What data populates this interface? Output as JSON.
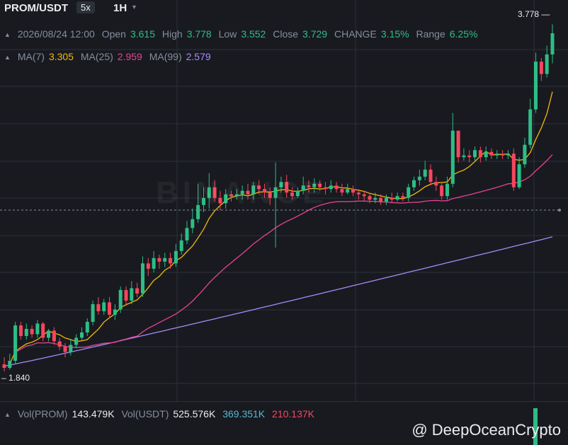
{
  "header": {
    "pair": "PROM/USDT",
    "leverage": "5x",
    "interval": "1H",
    "interval_caret": "▾"
  },
  "ohlc": {
    "time": "2026/08/24 12:00",
    "open_label": "Open",
    "open": "3.615",
    "high_label": "High",
    "high": "3.778",
    "low_label": "Low",
    "low": "3.552",
    "close_label": "Close",
    "close": "3.729",
    "change_label": "CHANGE",
    "change": "3.15%",
    "range_label": "Range",
    "range": "6.25%"
  },
  "ma": {
    "ma7_label": "MA(7)",
    "ma7": "3.305",
    "ma25_label": "MA(25)",
    "ma25": "2.959",
    "ma99_label": "MA(99)",
    "ma99": "2.579"
  },
  "markers": {
    "high": "3.778",
    "low": "1.840"
  },
  "volume": {
    "vol_prom_label": "Vol(PROM)",
    "vol_prom": "143.479K",
    "vol_usdt_label": "Vol(USDT)",
    "vol_usdt": "525.576K",
    "vol_a": "369.351K",
    "vol_b": "210.137K"
  },
  "watermark": {
    "logo_text": "BINANCE",
    "handle": "@ DeepOceanCrypto"
  },
  "colors": {
    "up": "#2ebd85",
    "down": "#f6465d",
    "ma7": "#f0b90b",
    "ma25": "#e84393",
    "ma99": "#a78bfa",
    "background": "#181a20",
    "grid": "#2b3139"
  },
  "chart_data": {
    "type": "candlestick",
    "title": "PROM/USDT",
    "interval": "1H",
    "ylim": [
      1.75,
      3.85
    ],
    "candles": [
      [
        1.86,
        1.84,
        1.82,
        1.9
      ],
      [
        1.84,
        1.88,
        1.83,
        1.92
      ],
      [
        1.88,
        2.08,
        1.86,
        2.1
      ],
      [
        2.08,
        2.02,
        2.0,
        2.1
      ],
      [
        2.02,
        2.06,
        2.0,
        2.09
      ],
      [
        2.06,
        2.03,
        2.01,
        2.08
      ],
      [
        2.03,
        2.09,
        2.01,
        2.11
      ],
      [
        2.09,
        2.01,
        1.99,
        2.1
      ],
      [
        2.01,
        2.05,
        1.99,
        2.06
      ],
      [
        2.05,
        1.99,
        1.97,
        2.07
      ],
      [
        1.99,
        1.96,
        1.94,
        2.01
      ],
      [
        1.96,
        1.93,
        1.9,
        1.98
      ],
      [
        1.93,
        1.97,
        1.91,
        2.0
      ],
      [
        1.97,
        2.01,
        1.95,
        2.03
      ],
      [
        2.01,
        2.04,
        1.99,
        2.07
      ],
      [
        2.04,
        2.1,
        2.02,
        2.12
      ],
      [
        2.1,
        2.2,
        2.08,
        2.22
      ],
      [
        2.2,
        2.16,
        2.14,
        2.24
      ],
      [
        2.16,
        2.21,
        2.14,
        2.23
      ],
      [
        2.21,
        2.14,
        2.12,
        2.24
      ],
      [
        2.14,
        2.17,
        2.11,
        2.2
      ],
      [
        2.17,
        2.28,
        2.15,
        2.3
      ],
      [
        2.28,
        2.22,
        2.19,
        2.3
      ],
      [
        2.22,
        2.29,
        2.2,
        2.33
      ],
      [
        2.29,
        2.26,
        2.24,
        2.32
      ],
      [
        2.26,
        2.43,
        2.24,
        2.47
      ],
      [
        2.43,
        2.4,
        2.36,
        2.46
      ],
      [
        2.4,
        2.46,
        2.38,
        2.5
      ],
      [
        2.46,
        2.44,
        2.4,
        2.48
      ],
      [
        2.44,
        2.46,
        2.41,
        2.49
      ],
      [
        2.46,
        2.43,
        2.4,
        2.49
      ],
      [
        2.43,
        2.5,
        2.41,
        2.54
      ],
      [
        2.5,
        2.56,
        2.48,
        2.6
      ],
      [
        2.56,
        2.63,
        2.54,
        2.67
      ],
      [
        2.63,
        2.68,
        2.6,
        2.74
      ],
      [
        2.68,
        2.76,
        2.66,
        2.88
      ],
      [
        2.76,
        2.8,
        2.72,
        2.86
      ],
      [
        2.8,
        2.86,
        2.74,
        2.94
      ],
      [
        2.86,
        2.8,
        2.78,
        2.9
      ],
      [
        2.8,
        2.77,
        2.73,
        2.84
      ],
      [
        2.77,
        2.82,
        2.74,
        2.85
      ],
      [
        2.82,
        2.81,
        2.78,
        2.84
      ],
      [
        2.81,
        2.82,
        2.79,
        2.85
      ],
      [
        2.82,
        2.84,
        2.79,
        2.87
      ],
      [
        2.84,
        2.82,
        2.79,
        2.88
      ],
      [
        2.82,
        2.87,
        2.79,
        2.89
      ],
      [
        2.87,
        2.85,
        2.82,
        2.9
      ],
      [
        2.85,
        2.83,
        2.8,
        2.88
      ],
      [
        2.83,
        2.8,
        2.76,
        2.86
      ],
      [
        2.8,
        2.86,
        2.52,
        3.0
      ],
      [
        2.86,
        2.89,
        2.83,
        2.92
      ],
      [
        2.89,
        2.83,
        2.8,
        2.93
      ],
      [
        2.83,
        2.81,
        2.79,
        2.86
      ],
      [
        2.81,
        2.84,
        2.8,
        2.86
      ],
      [
        2.84,
        2.87,
        2.82,
        2.92
      ],
      [
        2.87,
        2.86,
        2.83,
        2.9
      ],
      [
        2.86,
        2.88,
        2.83,
        2.91
      ],
      [
        2.88,
        2.86,
        2.84,
        2.9
      ],
      [
        2.86,
        2.85,
        2.82,
        2.89
      ],
      [
        2.85,
        2.87,
        2.83,
        2.9
      ],
      [
        2.87,
        2.85,
        2.83,
        2.89
      ],
      [
        2.85,
        2.83,
        2.81,
        2.88
      ],
      [
        2.83,
        2.85,
        2.82,
        2.88
      ],
      [
        2.85,
        2.83,
        2.81,
        2.87
      ],
      [
        2.83,
        2.82,
        2.79,
        2.85
      ],
      [
        2.82,
        2.81,
        2.78,
        2.84
      ],
      [
        2.81,
        2.79,
        2.77,
        2.83
      ],
      [
        2.79,
        2.8,
        2.77,
        2.83
      ],
      [
        2.8,
        2.78,
        2.76,
        2.82
      ],
      [
        2.78,
        2.8,
        2.76,
        2.82
      ],
      [
        2.8,
        2.79,
        2.77,
        2.83
      ],
      [
        2.79,
        2.81,
        2.78,
        2.83
      ],
      [
        2.81,
        2.8,
        2.78,
        2.83
      ],
      [
        2.8,
        2.86,
        2.78,
        2.88
      ],
      [
        2.86,
        2.9,
        2.84,
        2.92
      ],
      [
        2.9,
        2.92,
        2.87,
        2.96
      ],
      [
        2.92,
        2.96,
        2.9,
        3.01
      ],
      [
        2.96,
        2.89,
        2.87,
        2.99
      ],
      [
        2.89,
        2.87,
        2.84,
        2.92
      ],
      [
        2.87,
        2.81,
        2.79,
        2.89
      ],
      [
        2.81,
        2.88,
        2.79,
        2.92
      ],
      [
        2.88,
        3.18,
        2.86,
        3.28
      ],
      [
        3.18,
        3.03,
        3.0,
        3.15
      ],
      [
        3.03,
        3.04,
        3.01,
        3.08
      ],
      [
        3.04,
        3.03,
        3.0,
        3.07
      ],
      [
        3.03,
        3.07,
        3.01,
        3.09
      ],
      [
        3.07,
        3.03,
        3.0,
        3.09
      ],
      [
        3.03,
        3.06,
        3.01,
        3.09
      ],
      [
        3.06,
        3.04,
        3.02,
        3.08
      ],
      [
        3.04,
        3.05,
        3.02,
        3.07
      ],
      [
        3.05,
        3.04,
        3.02,
        3.07
      ],
      [
        3.04,
        3.05,
        3.02,
        3.07
      ],
      [
        3.05,
        2.86,
        2.84,
        3.08
      ],
      [
        2.86,
        2.99,
        2.85,
        3.03
      ],
      [
        2.99,
        3.1,
        2.97,
        3.14
      ],
      [
        3.1,
        3.3,
        3.08,
        3.36
      ],
      [
        3.3,
        3.57,
        3.28,
        3.62
      ],
      [
        3.57,
        3.5,
        3.46,
        3.59
      ],
      [
        3.5,
        3.61,
        3.48,
        3.66
      ],
      [
        3.61,
        3.73,
        3.56,
        3.78
      ]
    ],
    "volume_last_bar": "143.479K"
  }
}
